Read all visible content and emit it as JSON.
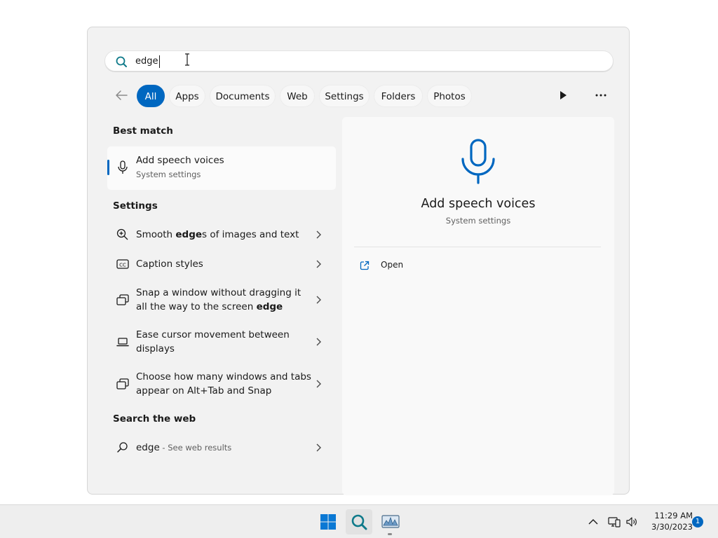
{
  "search": {
    "query": "edge"
  },
  "filter_tabs": [
    {
      "label": "All",
      "active": true
    },
    {
      "label": "Apps",
      "active": false
    },
    {
      "label": "Documents",
      "active": false
    },
    {
      "label": "Web",
      "active": false
    },
    {
      "label": "Settings",
      "active": false
    },
    {
      "label": "Folders",
      "active": false
    },
    {
      "label": "Photos",
      "active": false
    }
  ],
  "best_match": {
    "section_label": "Best match",
    "title": "Add speech voices",
    "subtitle": "System settings",
    "icon": "microphone-icon"
  },
  "settings": {
    "section_label": "Settings",
    "items": [
      {
        "icon": "zoom-icon",
        "text_before": "Smooth ",
        "bold": "edge",
        "text_after": "s of images and text"
      },
      {
        "icon": "closed-caption-icon",
        "text_before": "Caption styles",
        "bold": "",
        "text_after": ""
      },
      {
        "icon": "snap-window-icon",
        "text_before": "Snap a window without dragging it all the way to the screen ",
        "bold": "edge",
        "text_after": ""
      },
      {
        "icon": "laptop-icon",
        "text_before": "Ease cursor movement between displays",
        "bold": "",
        "text_after": ""
      },
      {
        "icon": "snap-window-icon",
        "text_before": "Choose how many windows and tabs appear on Alt+Tab and Snap",
        "bold": "",
        "text_after": ""
      }
    ]
  },
  "web": {
    "section_label": "Search the web",
    "query": "edge",
    "suffix": " - See web results"
  },
  "preview": {
    "title": "Add speech voices",
    "subtitle": "System settings",
    "action_label": "Open"
  },
  "taskbar": {
    "time": "11:29 AM",
    "date": "3/30/2023",
    "notification_count": "1"
  },
  "colors": {
    "accent": "#0067c0",
    "panel_bg": "#f2f2f2"
  }
}
